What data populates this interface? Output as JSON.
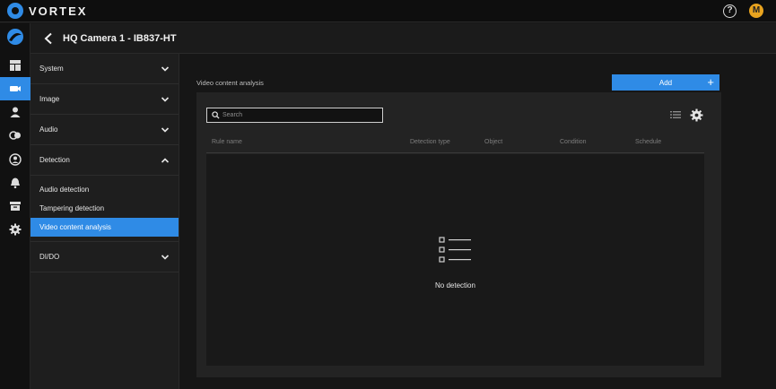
{
  "app": {
    "name": "VORTEX",
    "help_symbol": "?",
    "user_initial": "M"
  },
  "rail": {
    "items": [
      {
        "name": "dashboard-icon",
        "active": false
      },
      {
        "name": "camera-icon",
        "active": true
      },
      {
        "name": "user-icon",
        "active": false
      },
      {
        "name": "devices-icon",
        "active": false
      },
      {
        "name": "account-icon",
        "active": false
      },
      {
        "name": "bell-icon",
        "active": false
      },
      {
        "name": "archive-icon",
        "active": false
      },
      {
        "name": "gear-icon",
        "active": false
      }
    ]
  },
  "header": {
    "title": "HQ Camera 1 - IB837-HT"
  },
  "menu": {
    "system": "System",
    "image": "Image",
    "audio": "Audio",
    "detection": "Detection",
    "detection_items": [
      "Audio detection",
      "Tampering detection",
      "Video content analysis"
    ],
    "active_item": "Video content analysis",
    "didoo": "DI/DO"
  },
  "content": {
    "section_label": "Video content analysis",
    "add_label": "Add",
    "add_symbol": "+",
    "search_placeholder": "Search",
    "columns": [
      "Rule name",
      "Detection type",
      "Object",
      "Condition",
      "Schedule"
    ],
    "empty_message": "No detection"
  },
  "colors": {
    "accent": "#2f8be6",
    "avatar": "#e8a31f",
    "background": "#161616"
  }
}
